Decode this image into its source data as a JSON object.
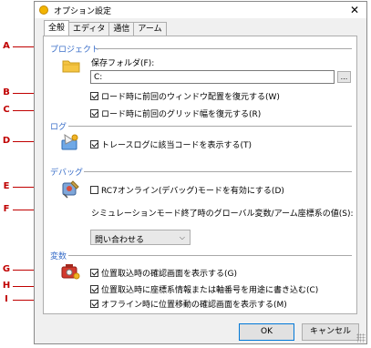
{
  "window": {
    "title": "オプション設定",
    "close_glyph": "✕",
    "tabs": [
      "全般",
      "エディタ",
      "通信",
      "アーム"
    ]
  },
  "callouts": [
    "A",
    "B",
    "C",
    "D",
    "E",
    "F",
    "G",
    "H",
    "I"
  ],
  "sections": {
    "project": {
      "title": "プロジェクト",
      "folder_label": "保存フォルダ(F):",
      "folder_value": "C:",
      "browse_label": "...",
      "restore_window": "ロード時に前回のウィンドウ配置を復元する(W)",
      "restore_grid": "ロード時に前回のグリッド幅を復元する(R)"
    },
    "log": {
      "title": "ログ",
      "trace_code": "トレースログに該当コードを表示する(T)"
    },
    "debug": {
      "title": "デバッグ",
      "rc7_online": "RC7オンライン(デバッグ)モードを有効にする(D)",
      "sim_end_label": "シミュレーションモード終了時のグローバル変数/アーム座標系の値(S):",
      "sim_end_value": "問い合わせる"
    },
    "variables": {
      "title": "変数",
      "confirm_position": "位置取込時の確認画面を表示する(G)",
      "write_coord_info": "位置取込時に座標系情報または軸番号を用途に書き込む(C)",
      "confirm_offline": "オフライン時に位置移動の確認画面を表示する(M)"
    }
  },
  "checkbox_states": {
    "restore_window": true,
    "restore_grid": true,
    "trace_code": true,
    "rc7_online": false,
    "confirm_position": true,
    "write_coord_info": true,
    "confirm_offline": true
  },
  "footer": {
    "ok": "OK",
    "cancel": "キャンセル"
  },
  "colors": {
    "callout": "#c00000",
    "section_title": "#3b6fc9",
    "default_button_border": "#0078d7"
  },
  "icons": [
    "options-app-icon",
    "folder-icon",
    "log-icon",
    "debug-icon",
    "variable-icon"
  ]
}
